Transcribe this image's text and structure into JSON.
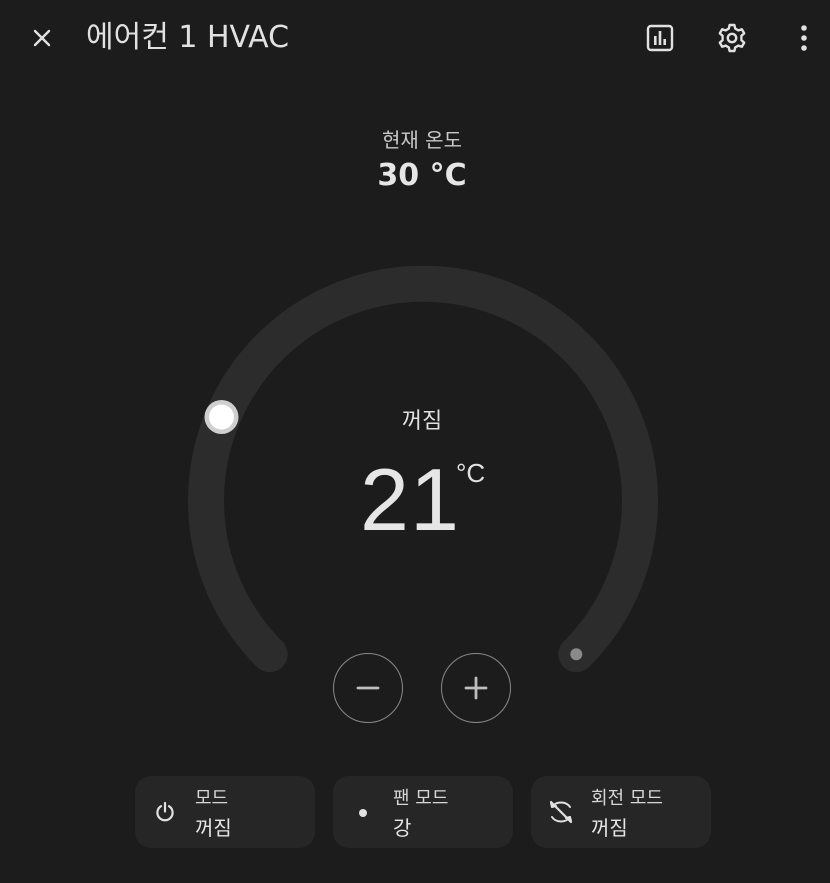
{
  "header": {
    "title": "에어컨 1 HVAC",
    "close_icon": "close-icon",
    "history_icon": "chart-box-icon",
    "settings_icon": "gear-icon",
    "more_icon": "dots-vertical-icon"
  },
  "current_temperature": {
    "label": "현재 온도",
    "value": "30 °C"
  },
  "thermostat": {
    "state": "꺼짐",
    "target": "21",
    "unit": "°C",
    "decrease_icon": "minus-icon",
    "increase_icon": "plus-icon"
  },
  "controls": [
    {
      "label": "모드",
      "value": "꺼짐",
      "icon": "power-icon"
    },
    {
      "label": "팬 모드",
      "value": "강",
      "icon": "circle-small-icon"
    },
    {
      "label": "회전 모드",
      "value": "꺼짐",
      "icon": "swing-off-icon"
    }
  ],
  "colors": {
    "background": "#1c1c1c",
    "track": "#2c2c2c",
    "chip_background": "#262626",
    "text": "#e1e1e1"
  }
}
